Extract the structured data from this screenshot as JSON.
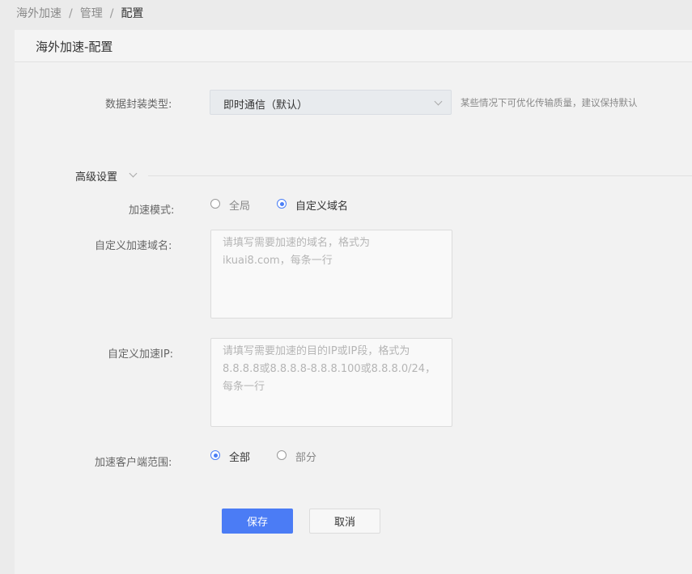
{
  "breadcrumb": {
    "item1": "海外加速",
    "item2": "管理",
    "current": "配置",
    "separator": "/"
  },
  "panel": {
    "title": "海外加速-配置"
  },
  "encap": {
    "label": "数据封装类型:",
    "value": "即时通信（默认）",
    "hint": "某些情况下可优化传输质量，建议保持默认"
  },
  "advanced": {
    "title": "高级设置"
  },
  "mode": {
    "label": "加速模式:",
    "options": [
      "全局",
      "自定义域名"
    ],
    "selected": "自定义域名"
  },
  "domain": {
    "label": "自定义加速域名:",
    "placeholder": "请填写需要加速的域名，格式为 ikuai8.com，每条一行"
  },
  "ip": {
    "label": "自定义加速IP:",
    "placeholder": "请填写需要加速的目的IP或IP段，格式为 8.8.8.8或8.8.8.8-8.8.8.100或8.8.8.0/24，每条一行"
  },
  "scope": {
    "label": "加速客户端范围:",
    "options": [
      "全部",
      "部分"
    ],
    "selected": "全部"
  },
  "buttons": {
    "save": "保存",
    "cancel": "取消"
  },
  "colors": {
    "accent": "#4b7cf5",
    "background": "#f2f2f2"
  }
}
